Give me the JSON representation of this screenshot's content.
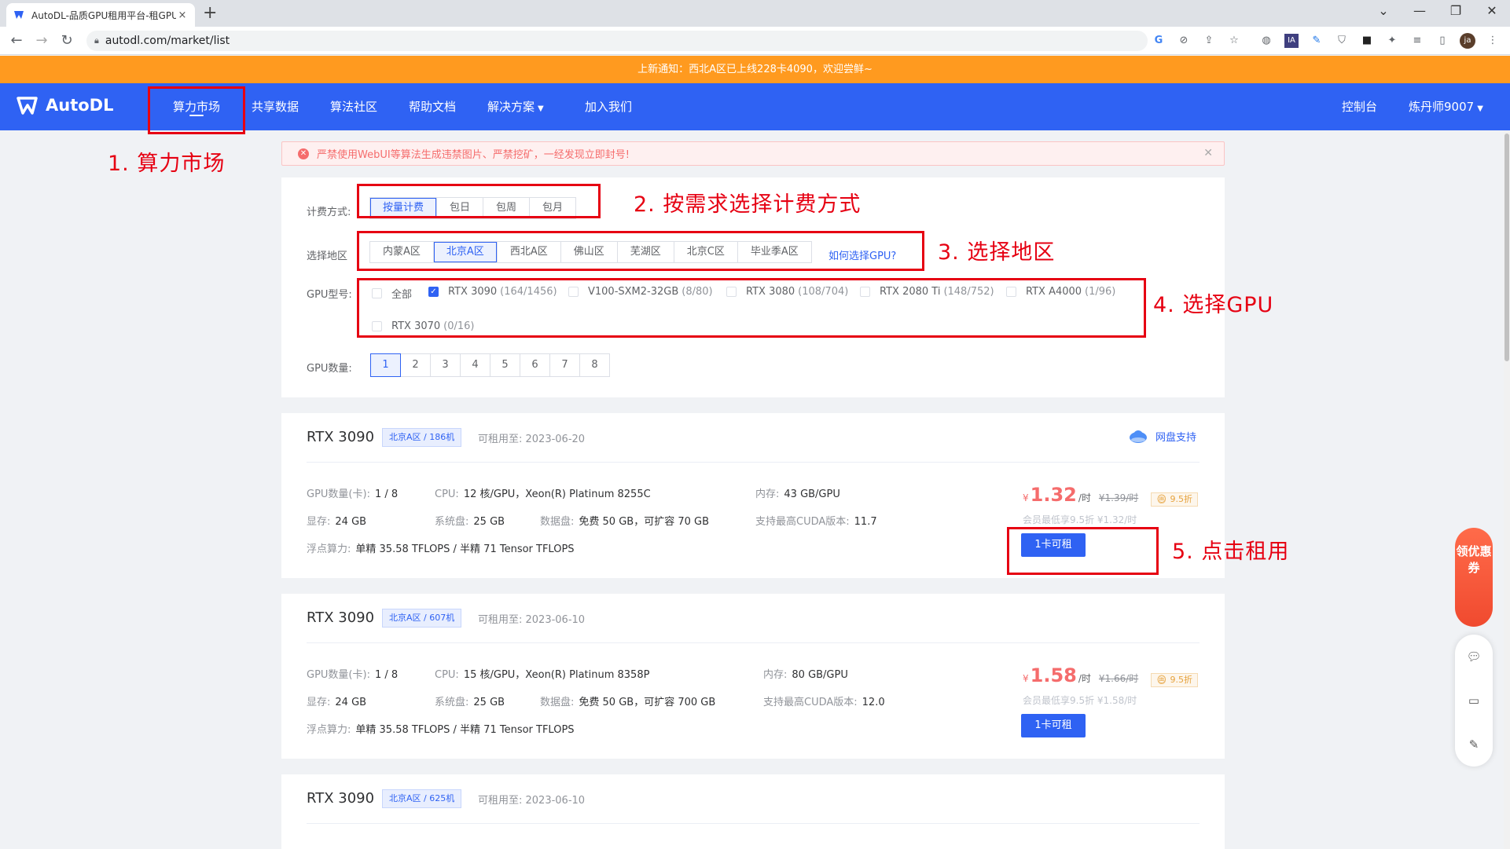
{
  "browser": {
    "tab_title": "AutoDL-品质GPU租用平台-租GPU",
    "tab_close": "×",
    "new_tab": "+",
    "url": "autodl.com/market/list",
    "window_controls": [
      "⌄",
      "—",
      "❐",
      "✕"
    ],
    "extension_icons": [
      "G",
      "⊘",
      "⇪",
      "☆",
      "◍",
      "IA",
      "✎",
      "⛉",
      "■",
      "✦",
      "≡",
      "▯"
    ],
    "profile_initials": "ja"
  },
  "notice": "上新通知：西北A区已上线228卡4090，欢迎尝鲜~",
  "site_nav": {
    "logo_text": "AutoDL",
    "items": [
      "算力市场",
      "共享数据",
      "算法社区",
      "帮助文档",
      "解决方案",
      "加入我们"
    ],
    "console": "控制台",
    "user": "炼丹师9007"
  },
  "alert": "严禁使用WebUI等算法生成违禁图片、严禁挖矿，一经发现立即封号!",
  "filters": {
    "billing_label": "计费方式:",
    "billing_options": [
      "按量计费",
      "包日",
      "包周",
      "包月"
    ],
    "billing_selected": 0,
    "region_label": "选择地区",
    "regions": [
      "内蒙A区",
      "北京A区",
      "西北A区",
      "佛山区",
      "芜湖区",
      "北京C区",
      "毕业季A区"
    ],
    "region_selected": 1,
    "region_help": "如何选择GPU?",
    "gpu_label": "GPU型号:",
    "gpu_models": [
      {
        "name": "全部",
        "count": "",
        "checked": false
      },
      {
        "name": "RTX 3090",
        "count": "(164/1456)",
        "checked": true
      },
      {
        "name": "V100-SXM2-32GB",
        "count": "(8/80)",
        "checked": false
      },
      {
        "name": "RTX 3080",
        "count": "(108/704)",
        "checked": false
      },
      {
        "name": "RTX 2080 Ti",
        "count": "(148/752)",
        "checked": false
      },
      {
        "name": "RTX A4000",
        "count": "(1/96)",
        "checked": false
      },
      {
        "name": "RTX 3070",
        "count": "(0/16)",
        "checked": false
      }
    ],
    "count_label": "GPU数量:",
    "gpu_counts": [
      "1",
      "2",
      "3",
      "4",
      "5",
      "6",
      "7",
      "8"
    ],
    "count_selected": 0
  },
  "listings": [
    {
      "name": "RTX 3090",
      "tag": "北京A区 / 186机",
      "avail": "可租用至: 2023-06-20",
      "gpu_count_label": "GPU数量(卡):",
      "gpu_count": "1 / 8",
      "cpu_label": "CPU:",
      "cpu": "12 核/GPU，Xeon(R) Platinum 8255C",
      "mem_label": "内存:",
      "mem": "43 GB/GPU",
      "vram_label": "显存:",
      "vram": "24 GB",
      "sysdisk_label": "系统盘:",
      "sysdisk": "25 GB",
      "datadisk_label": "数据盘:",
      "datadisk": "免费 50 GB，可扩容 70 GB",
      "cuda_label": "支持最高CUDA版本:",
      "cuda": "11.7",
      "flops_label": "浮点算力:",
      "flops": "单精 35.58 TFLOPS / 半精 71 Tensor TFLOPS",
      "price_symbol": "¥",
      "price": "1.32",
      "price_unit": "/时",
      "orig_price": "¥1.39/时",
      "discount": "9.5折",
      "member": "会员最低享9.5折 ¥1.32/时",
      "rent": "1卡可租",
      "pan": "网盘支持"
    },
    {
      "name": "RTX 3090",
      "tag": "北京A区 / 607机",
      "avail": "可租用至: 2023-06-10",
      "gpu_count_label": "GPU数量(卡):",
      "gpu_count": "1 / 8",
      "cpu_label": "CPU:",
      "cpu": "15 核/GPU，Xeon(R) Platinum 8358P",
      "mem_label": "内存:",
      "mem": "80 GB/GPU",
      "vram_label": "显存:",
      "vram": "24 GB",
      "sysdisk_label": "系统盘:",
      "sysdisk": "25 GB",
      "datadisk_label": "数据盘:",
      "datadisk": "免费 50 GB，可扩容 700 GB",
      "cuda_label": "支持最高CUDA版本:",
      "cuda": "12.0",
      "flops_label": "浮点算力:",
      "flops": "单精 35.58 TFLOPS / 半精 71 Tensor TFLOPS",
      "price_symbol": "¥",
      "price": "1.58",
      "price_unit": "/时",
      "orig_price": "¥1.66/时",
      "discount": "9.5折",
      "member": "会员最低享9.5折 ¥1.58/时",
      "rent": "1卡可租"
    },
    {
      "name": "RTX 3090",
      "tag": "北京A区 / 625机",
      "avail": "可租用至: 2023-06-10"
    }
  ],
  "annotations": [
    "1. 算力市场",
    "2. 按需求选择计费方式",
    "3. 选择地区",
    "4. 选择GPU",
    "5. 点击租用"
  ],
  "widgets": {
    "coupon": "领优惠券",
    "icons": [
      "wechat-icon",
      "chat-icon",
      "feedback-icon"
    ]
  },
  "colors": {
    "brand_blue": "#2f62f3",
    "notice_orange": "#ff9a1f",
    "price_red": "#f56c6c",
    "annotation_red": "#e60012"
  }
}
